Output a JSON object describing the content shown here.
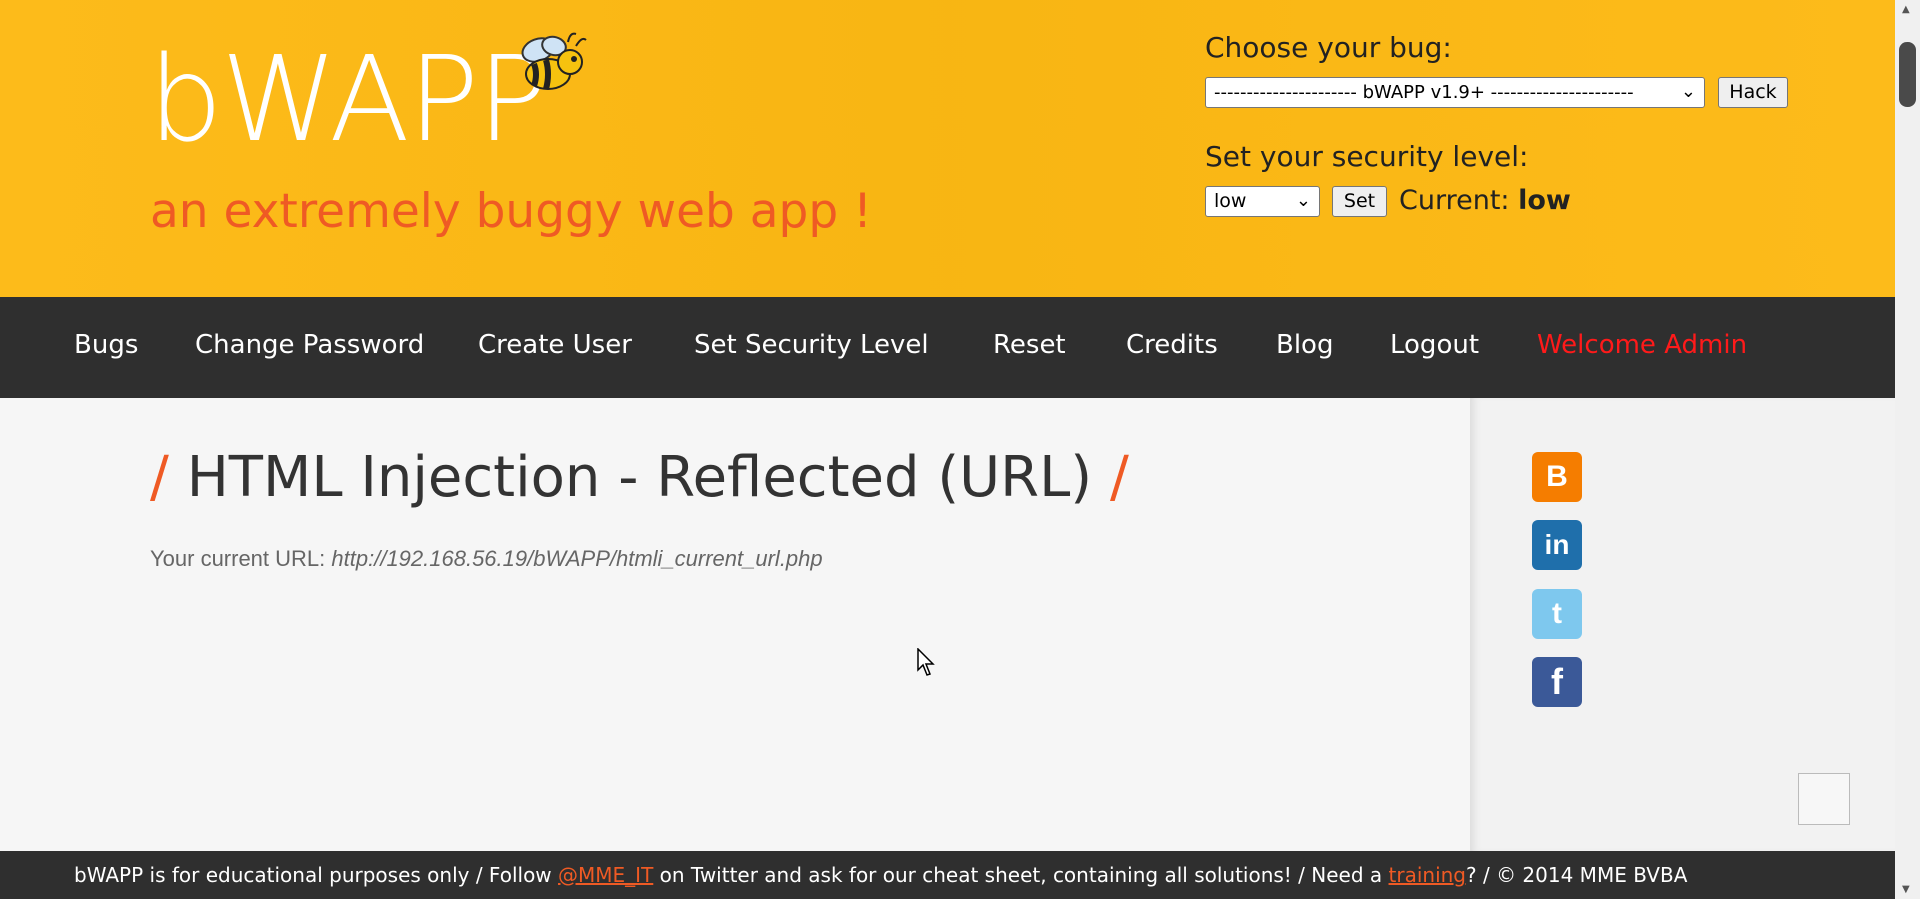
{
  "header": {
    "logo": "bWAPP",
    "tagline": "an extremely buggy web app !",
    "choose_bug_label": "Choose your bug:",
    "bug_select_value": "---------------------- bWAPP v1.9+ ----------------------",
    "hack_button": "Hack",
    "security_label": "Set your security level:",
    "security_select_value": "low",
    "set_button": "Set",
    "current_label": "Current:",
    "current_value": "low"
  },
  "nav": {
    "items": [
      "Bugs",
      "Change Password",
      "Create User",
      "Set Security Level",
      "Reset",
      "Credits",
      "Blog",
      "Logout"
    ],
    "welcome": "Welcome Admin"
  },
  "main": {
    "title": "HTML Injection - Reflected (URL)",
    "title_slash": "/",
    "url_label": "Your current URL:",
    "url_value": "http://192.168.56.19/bWAPP/htmli_current_url.php"
  },
  "sidebar": {
    "icons": [
      "blogger-icon",
      "linkedin-icon",
      "twitter-icon",
      "facebook-icon"
    ]
  },
  "footer": {
    "part1": "bWAPP is for educational purposes only / Follow ",
    "twitter_link": "@MME_IT",
    "part2": " on Twitter and ask for our cheat sheet, containing all solutions! / Need a ",
    "training_link": "training",
    "part3": "? / © 2014 MME BVBA"
  },
  "colors": {
    "header_bg": "#fdb913",
    "accent": "#ef5a24",
    "nav_bg": "#2f2f2f",
    "welcome": "#ff1a1a"
  }
}
